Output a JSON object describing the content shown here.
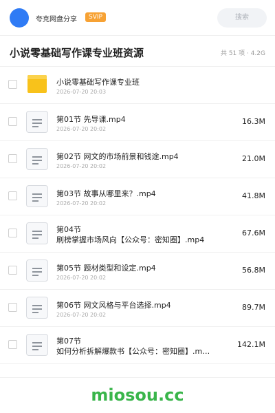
{
  "header": {
    "user_name": "夸克网盘分享",
    "badge": "SVIP",
    "search_placeholder": "搜索"
  },
  "folder": {
    "title": "小说零基础写作课专业班资源",
    "meta": "共 51 项 · 4.2G"
  },
  "items": [
    {
      "type": "folder",
      "name": "小说零基础写作课专业班",
      "date": "2026-07-20 20:03",
      "size": ""
    },
    {
      "type": "file",
      "name": "第01节 先导课.mp4",
      "date": "2026-07-20 20:02",
      "size": "16.3M"
    },
    {
      "type": "file",
      "name": "第02节 网文的市场前景和钱途.mp4",
      "date": "2026-07-20 20:02",
      "size": "21.0M"
    },
    {
      "type": "file",
      "name": "第03节 故事从哪里来？.mp4",
      "date": "2026-07-20 20:02",
      "size": "41.8M"
    },
    {
      "type": "file",
      "name_line1": "第04节",
      "name_line2": "刷榜掌握市场风向【公众号：密知圈】.mp4",
      "date": "2026-07-20 20:02",
      "size": "67.6M"
    },
    {
      "type": "file",
      "name": "第05节 题材类型和设定.mp4",
      "date": "2026-07-20 20:02",
      "size": "56.8M"
    },
    {
      "type": "file",
      "name": "第06节 网文风格与平台选择.mp4",
      "date": "2026-07-20 20:02",
      "size": "89.7M"
    },
    {
      "type": "file",
      "name_line1": "第07节",
      "name_line2": "如何分析拆解爆款书【公众号：密知圈】.m…",
      "date": "2026-07-20 20:02",
      "size": "142.1M"
    }
  ],
  "watermark": "miosou.cc",
  "colors": {
    "avatar": "#2f7bf5",
    "badge": "#f7a234",
    "folder_icon": "#f8c21b",
    "watermark": "#39b54a"
  }
}
